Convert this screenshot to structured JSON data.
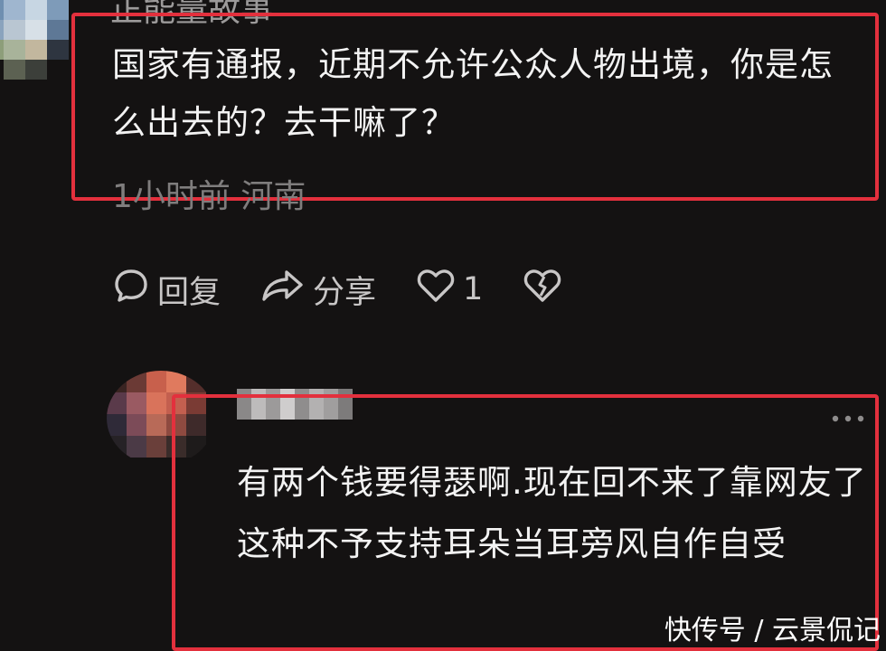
{
  "comment1": {
    "username": "正能量故事",
    "text": "国家有通报，近期不允许公众人物出境，你是怎么出去的？去干嘛了？",
    "meta": "1小时前 河南",
    "actions": {
      "reply_label": "回复",
      "share_label": "分享",
      "like_count": "1"
    }
  },
  "comment2": {
    "text": "有两个钱要得瑟啊.现在回不来了靠网友了这种不予支持耳朵当耳旁风自作自受"
  },
  "watermark": "快传号 / 云景侃记",
  "colors": {
    "background": "#141212",
    "highlight": "#e3303d",
    "muted_text": "#7f7d7d",
    "icon": "#c8c6c6"
  }
}
